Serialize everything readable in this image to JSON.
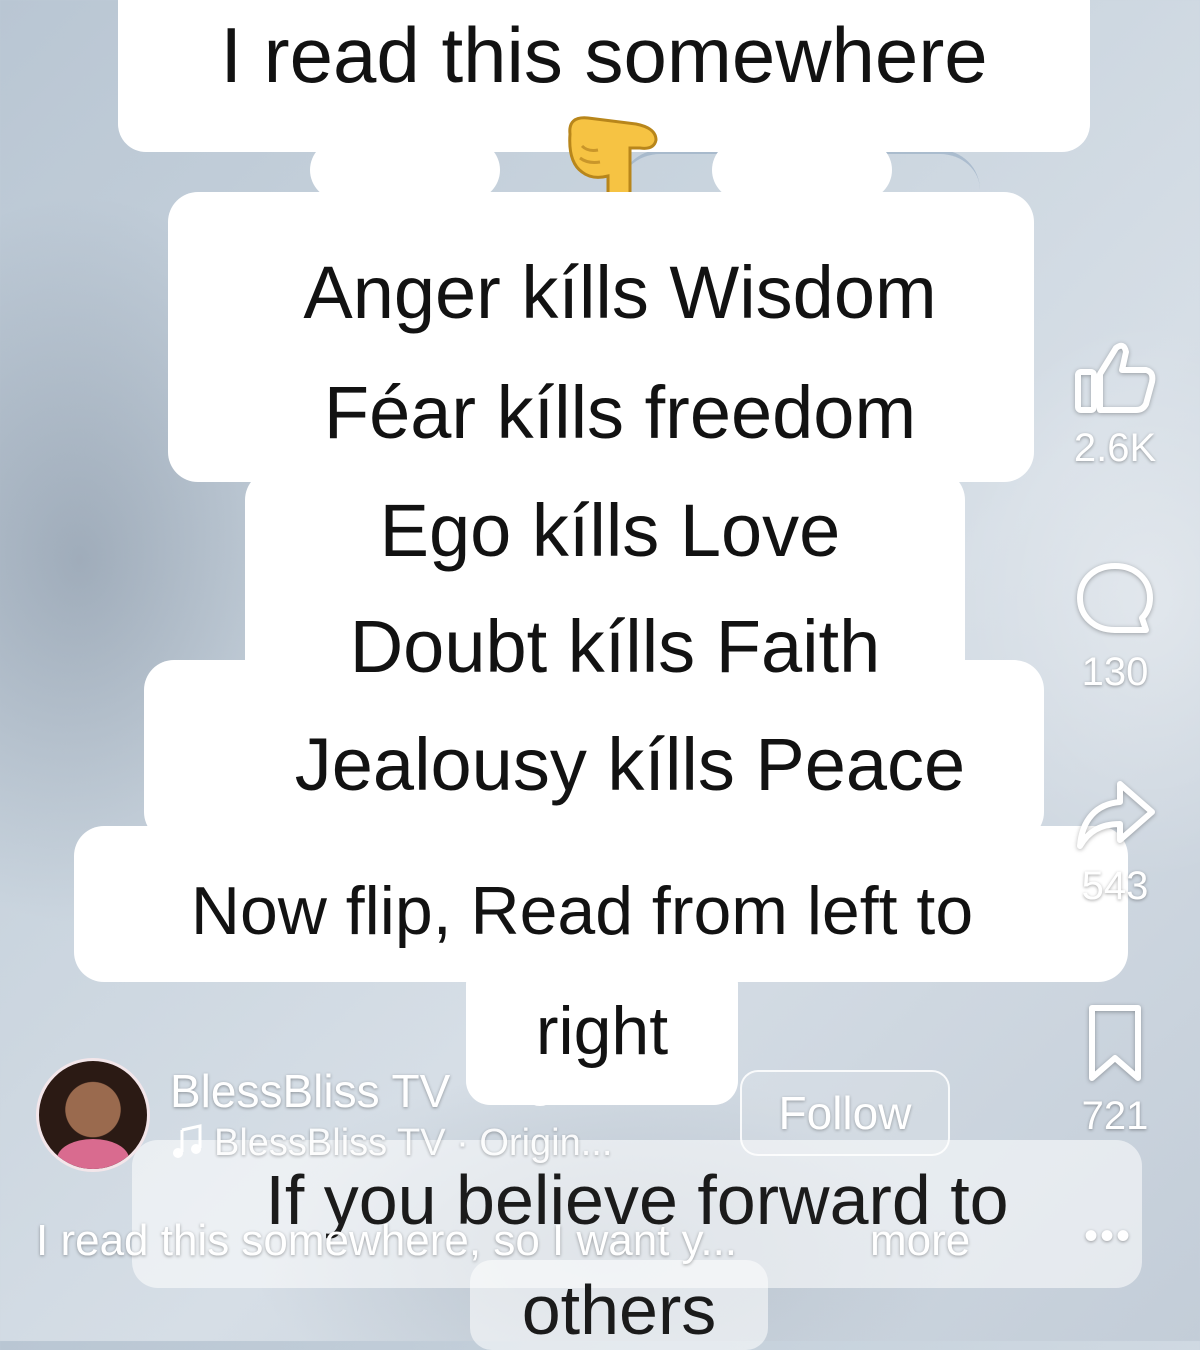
{
  "caption": {
    "title": "I read this somewhere",
    "lines": [
      "Anger kílls Wisdom",
      "Féar kílls freedom",
      "Ego kílls Love",
      "Doubt kílls Faith",
      "Jealousy kílls Peace"
    ],
    "flip_line1": "Now flip, Read from left to",
    "flip_line2": "right",
    "footer_line1": "If you believe forward to",
    "footer_line2": "others"
  },
  "actions": {
    "likes": "2.6K",
    "comments": "130",
    "shares": "543",
    "saves": "721"
  },
  "creator": {
    "name": "BlessBliss TV",
    "sound": "BlessBliss TV · Origin...",
    "follow_label": "Follow"
  },
  "description": {
    "text": "I read this somewhere, so I want y...",
    "more": "more",
    "menu": "•••"
  },
  "icons": [
    "thumbs-up-icon",
    "comment-icon",
    "share-icon",
    "bookmark-icon",
    "globe-icon",
    "music-note-icon",
    "pointing-down-emoji"
  ]
}
